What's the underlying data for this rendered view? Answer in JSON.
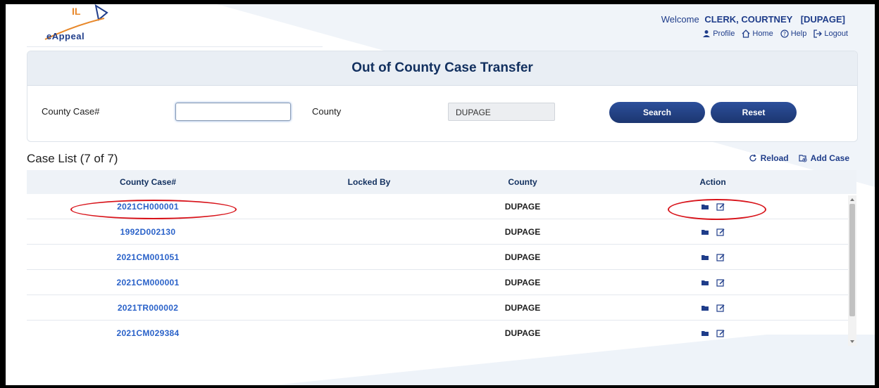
{
  "header": {
    "logo_top": "IL",
    "logo_text": "eAppeal",
    "welcome_label": "Welcome",
    "user": "CLERK, COURTNEY",
    "user_county": "[DUPAGE]",
    "nav": [
      "Profile",
      "Home",
      "Help",
      "Logout"
    ]
  },
  "panel": {
    "title": "Out of County Case Transfer",
    "case_label": "County Case#",
    "case_value": "",
    "county_label": "County",
    "county_value": "DUPAGE",
    "search_label": "Search",
    "reset_label": "Reset"
  },
  "list": {
    "title": "Case List (7 of 7)",
    "reload_label": "Reload",
    "add_label": "Add Case",
    "columns": [
      "County Case#",
      "Locked By",
      "County",
      "Action"
    ],
    "rows": [
      {
        "case": "2021CH000001",
        "locked_by": "",
        "county": "DUPAGE"
      },
      {
        "case": "1992D002130",
        "locked_by": "",
        "county": "DUPAGE"
      },
      {
        "case": "2021CM001051",
        "locked_by": "",
        "county": "DUPAGE"
      },
      {
        "case": "2021CM000001",
        "locked_by": "",
        "county": "DUPAGE"
      },
      {
        "case": "2021TR000002",
        "locked_by": "",
        "county": "DUPAGE"
      },
      {
        "case": "2021CM029384",
        "locked_by": "",
        "county": "DUPAGE"
      }
    ]
  },
  "colors": {
    "accent": "#1f3d8a",
    "link": "#2a62c9",
    "highlight_ellipse": "#d8141b"
  },
  "icons": [
    "profile-icon",
    "home-icon",
    "help-icon",
    "logout-icon",
    "reload-icon",
    "add-case-icon",
    "folder-icon",
    "edit-icon"
  ]
}
